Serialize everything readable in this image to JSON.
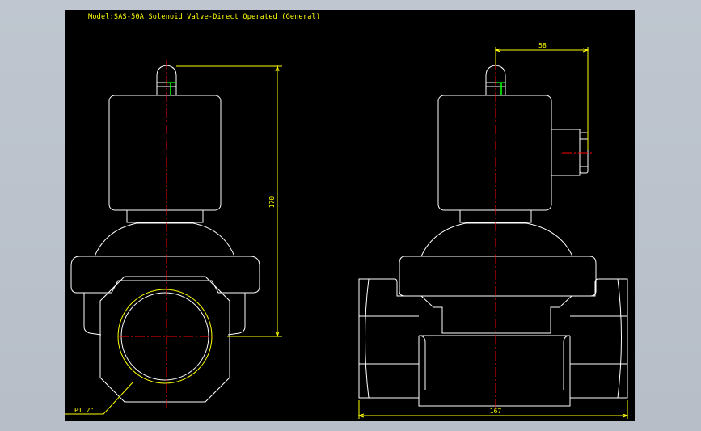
{
  "drawing": {
    "title": "Model:SAS-50A Solenoid Valve-Direct Operated (General)",
    "dimensions": {
      "height": "170",
      "coil_offset": "58",
      "length": "167"
    },
    "thread_label": "PT 2\""
  },
  "colors": {
    "background": "#000000",
    "outline": "#ffffff",
    "centerline": "#ff0000",
    "dimension": "#ffff00",
    "accent": "#00ff00",
    "frame": "#c0c6ce"
  }
}
